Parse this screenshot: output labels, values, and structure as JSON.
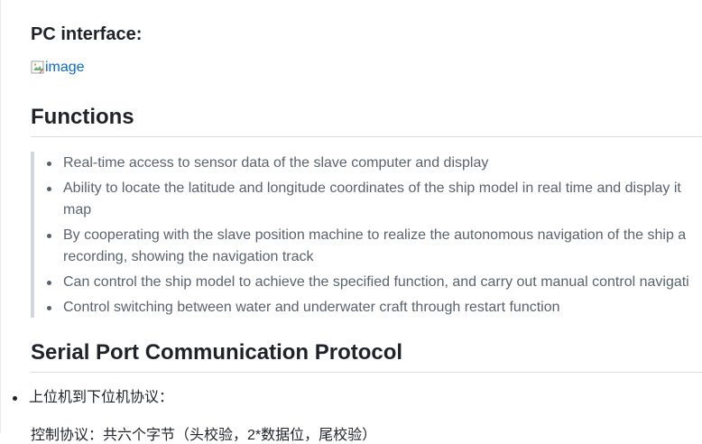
{
  "pc_interface": {
    "heading": "PC interface:",
    "image_alt": "image"
  },
  "functions": {
    "heading": "Functions",
    "items": [
      {
        "line1": "Real-time access to sensor data of the slave computer and display"
      },
      {
        "line1": "Ability to locate the latitude and longitude coordinates of the ship model in real time and display it",
        "line2": "map"
      },
      {
        "line1": "By cooperating with the slave position machine to realize the autonomous navigation of the ship a",
        "line2": "recording, showing the navigation track"
      },
      {
        "line1": "Can control the ship model to achieve the specified function, and carry out manual control navigati"
      },
      {
        "line1": "Control switching between water and underwater craft through restart function"
      }
    ]
  },
  "protocol": {
    "heading": "Serial Port Communication Protocol",
    "items": [
      {
        "label": "上位机到下位机协议："
      }
    ],
    "next_line": "控制协议：共六个字节（头校验，2*数据位，尾校验）"
  },
  "colors": {
    "link": "#0969da",
    "quote_text": "#59636e",
    "quote_bar": "#d0d7de"
  }
}
